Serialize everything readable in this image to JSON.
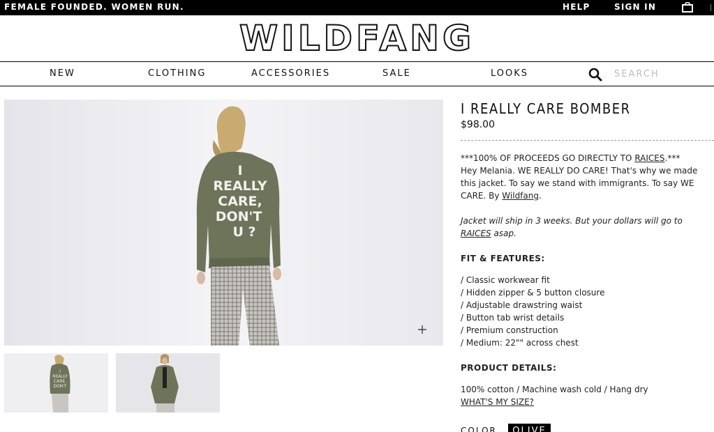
{
  "topbar": {
    "tagline": "FEMALE FOUNDED. WOMEN RUN.",
    "help": "HELP",
    "sign_in": "SIGN IN",
    "bag_icon": "shopping-bag-icon"
  },
  "logo": {
    "text": "WILDFANG"
  },
  "nav": {
    "items": [
      "NEW",
      "CLOTHING",
      "ACCESSORIES",
      "SALE",
      "LOOKS"
    ],
    "search_icon": "search-icon",
    "search_placeholder": "SEARCH"
  },
  "gallery": {
    "jacket_text": [
      "I",
      "REALLY",
      "CARE,",
      "DON'T",
      "U ?"
    ],
    "zoom_icon": "plus-icon"
  },
  "product": {
    "title": "I REALLY CARE BOMBER",
    "price": "$98.00",
    "desc_prefix": "***100% OF PROCEEDS GO DIRECTLY TO ",
    "desc_raices": "RAICES",
    "desc_suffix": ".***",
    "desc_body": "Hey Melania. WE REALLY DO CARE! That's why we made this jacket. To say we stand with immigrants. To say WE CARE. By ",
    "desc_brand": "Wildfang",
    "desc_end": ".",
    "ship_text": "Jacket will ship in 3 weeks. But your dollars will go to ",
    "ship_raices": "RAICES",
    "ship_end": " asap.",
    "fit_heading": "FIT & FEATURES:",
    "features": [
      "/ Classic workwear fit",
      "/ Hidden zipper & 5 button closure",
      "/ Adjustable drawstring waist",
      "/ Button tab wrist details",
      "/ Premium construction",
      "/ Medium: 22\"\" across chest"
    ],
    "details_heading": "PRODUCT DETAILS:",
    "details_text": "100% cotton / Machine wash cold / Hang dry",
    "size_link": "WHAT'S MY SIZE?",
    "color_label": "COLOR",
    "color_value": "OLIVE"
  },
  "colors": {
    "jacket": "#6e7459",
    "background": "#ededf1"
  }
}
